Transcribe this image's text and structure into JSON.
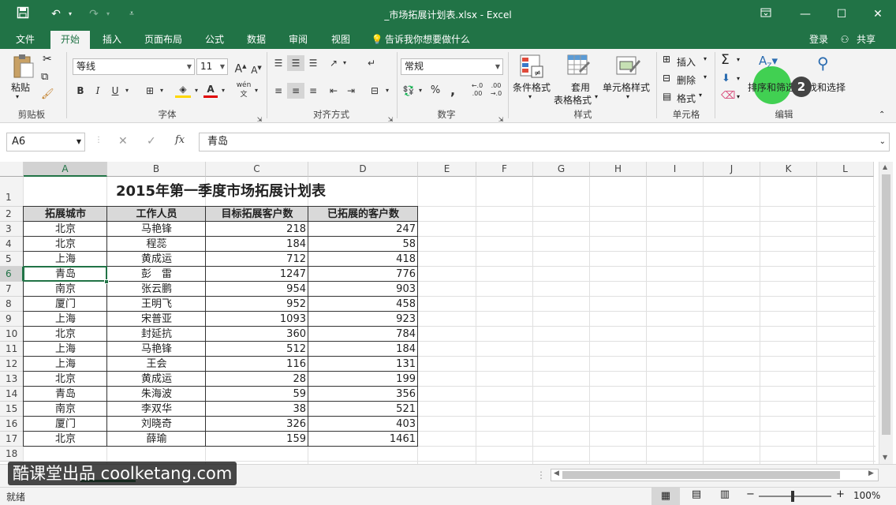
{
  "window": {
    "title": "_市场拓展计划表.xlsx - Excel"
  },
  "qat": {
    "save_icon": "save-icon",
    "undo_icon": "undo-icon",
    "redo_icon": "redo-icon",
    "customize_icon": "customize-qat-icon"
  },
  "tabs": [
    "文件",
    "开始",
    "插入",
    "页面布局",
    "公式",
    "数据",
    "审阅",
    "视图"
  ],
  "tell_me": "告诉我你想要做什么",
  "signin": "登录",
  "share": "共享",
  "ribbon": {
    "clipboard": {
      "paste": "粘贴",
      "label": "剪贴板"
    },
    "font": {
      "name": "等线",
      "size": "11",
      "bold": "B",
      "italic": "I",
      "underline": "U",
      "wen": "wén",
      "label": "字体"
    },
    "alignment": {
      "label": "对齐方式"
    },
    "number": {
      "format": "常规",
      "percent": "%",
      "comma": ",",
      "label": "数字"
    },
    "styles": {
      "conditional": "条件格式",
      "table_line1": "套用",
      "table_line2": "表格格式",
      "cell_styles": "单元格样式",
      "label": "样式"
    },
    "cells": {
      "insert": "插入",
      "delete": "删除",
      "format": "格式",
      "label": "单元格"
    },
    "editing": {
      "sort_filter": "排序和筛选",
      "find_select": "查找和选择",
      "label": "编辑",
      "badge": "2"
    }
  },
  "formula_bar": {
    "name_box": "A6",
    "fx": "fx",
    "value": "青岛"
  },
  "columns": [
    "A",
    "B",
    "C",
    "D",
    "E",
    "F",
    "G",
    "H",
    "I",
    "J",
    "K",
    "L"
  ],
  "rows": [
    "1",
    "2",
    "3",
    "4",
    "5",
    "6",
    "7",
    "8",
    "9",
    "10",
    "11",
    "12",
    "13",
    "14",
    "15",
    "16",
    "17",
    "18"
  ],
  "sheet": {
    "title": "2015年第一季度市场拓展计划表",
    "headers": [
      "拓展城市",
      "工作人员",
      "目标拓展客户数",
      "已拓展的客户数"
    ],
    "data": [
      [
        "北京",
        "马艳锋",
        "218",
        "247"
      ],
      [
        "北京",
        "程蕊",
        "184",
        "58"
      ],
      [
        "上海",
        "黄成运",
        "712",
        "418"
      ],
      [
        "青岛",
        "彭　雷",
        "1247",
        "776"
      ],
      [
        "南京",
        "张云鹏",
        "954",
        "903"
      ],
      [
        "厦门",
        "王明飞",
        "952",
        "458"
      ],
      [
        "上海",
        "宋普亚",
        "1093",
        "923"
      ],
      [
        "北京",
        "封延抗",
        "360",
        "784"
      ],
      [
        "上海",
        "马艳锋",
        "512",
        "184"
      ],
      [
        "上海",
        "王会",
        "116",
        "131"
      ],
      [
        "北京",
        "黄成运",
        "28",
        "199"
      ],
      [
        "青岛",
        "朱海波",
        "59",
        "356"
      ],
      [
        "南京",
        "李双华",
        "38",
        "521"
      ],
      [
        "厦门",
        "刘晓奇",
        "326",
        "403"
      ],
      [
        "北京",
        "薛瑜",
        "159",
        "1461"
      ]
    ]
  },
  "watermark": "酷课堂出品 coolketang.com",
  "status": {
    "ready": "就绪",
    "zoom": "100%"
  },
  "colors": {
    "excel_green": "#217346",
    "ribbon_bg": "#f3f3f3",
    "selection": "#217346",
    "highlight": "#2ecc40"
  }
}
